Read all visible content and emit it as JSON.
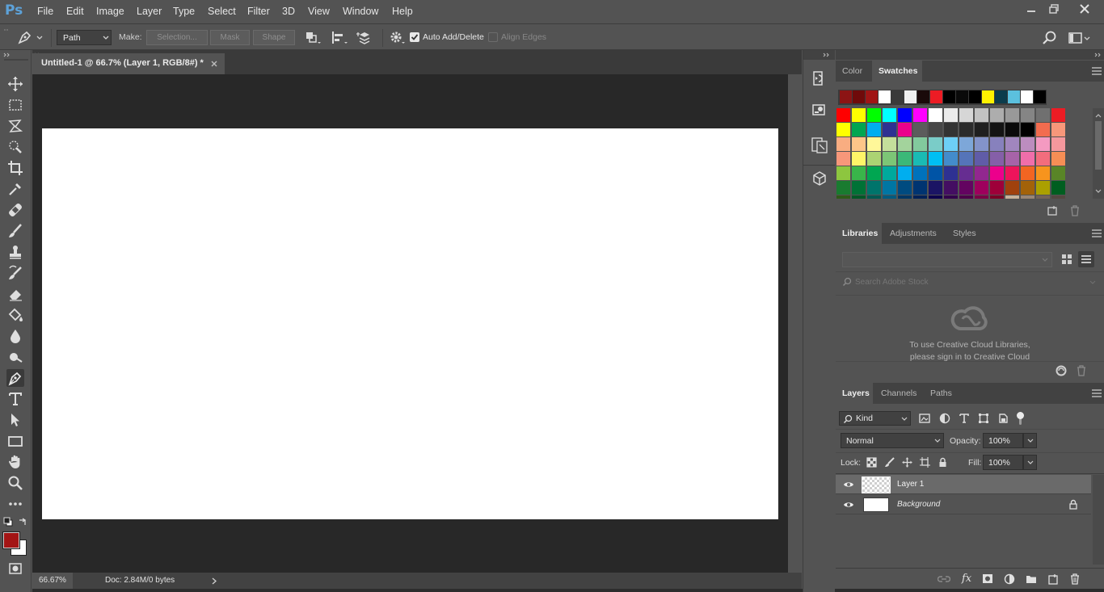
{
  "app": {
    "logo": "Ps"
  },
  "menu": [
    "File",
    "Edit",
    "Image",
    "Layer",
    "Type",
    "Select",
    "Filter",
    "3D",
    "View",
    "Window",
    "Help"
  ],
  "options": {
    "mode_value": "Path",
    "make_label": "Make:",
    "selection_btn": "Selection...",
    "mask_btn": "Mask",
    "shape_btn": "Shape",
    "auto_add_delete": "Auto Add/Delete",
    "auto_add_delete_checked": true,
    "align_edges": "Align Edges",
    "align_edges_checked": false
  },
  "document": {
    "tab_title": "Untitled-1 @ 66.7% (Layer 1, RGB/8#) *",
    "zoom": "66.67%",
    "doc_info": "Doc: 2.84M/0 bytes",
    "canvas_color": "#ffffff"
  },
  "toolbox": {
    "foreground_color": "#a31515",
    "background_color": "#ffffff",
    "active_tool": "pen-tool"
  },
  "annotation": {
    "arrow_color": "#ff0000",
    "points_to": "pen-tool"
  },
  "swatches_panel": {
    "tabs": [
      "Color",
      "Swatches"
    ],
    "active_tab": "Swatches",
    "recent": [
      "#8c1414",
      "#6f0a0a",
      "#a01515",
      "#ffffff",
      "#3a3a3a",
      "#f0f0f0",
      "#1a0a0a",
      "#ed1c24",
      "#000000",
      "#0a0a0a",
      "#000000",
      "#fff200",
      "#0b3c4c",
      "#5bc0de",
      "#ffffff",
      "#000000"
    ],
    "grid": [
      [
        "#ff0000",
        "#ffff00",
        "#00ff00",
        "#00ffff",
        "#0000ff",
        "#ff00ff",
        "#ffffff",
        "#ebebeb",
        "#d6d6d6",
        "#c2c2c2",
        "#adadad",
        "#999999",
        "#858585",
        "#707070",
        "#ed1c24"
      ],
      [
        "#ffff00",
        "#00a651",
        "#00aeef",
        "#2e3192",
        "#ec008c",
        "#5c5c5c",
        "#474747",
        "#333333",
        "#2b2b2b",
        "#1f1f1f",
        "#141414",
        "#0a0a0a",
        "#000000",
        "#f26c4f",
        "#f7977a"
      ],
      [
        "#f9ad81",
        "#fdc689",
        "#fff799",
        "#c4df9b",
        "#a3d39c",
        "#82ca9d",
        "#7accc8",
        "#6dcff6",
        "#7da7d9",
        "#8393ca",
        "#8781bd",
        "#a186be",
        "#bc8dbf",
        "#f49ac1",
        "#f5989d"
      ],
      [
        "#f7977a",
        "#fff568",
        "#acd373",
        "#7cc576",
        "#3bb878",
        "#1abbb4",
        "#00bff3",
        "#438ccb",
        "#5574b9",
        "#605ca8",
        "#855fa8",
        "#a763a8",
        "#f06eaa",
        "#f26d7d",
        "#f68e55"
      ],
      [
        "#8dc63f",
        "#39b54a",
        "#00a651",
        "#00a99d",
        "#00aeef",
        "#0072bc",
        "#0054a6",
        "#2e3192",
        "#662d91",
        "#92278f",
        "#ec008c",
        "#ed145b",
        "#f26522",
        "#f7941d",
        "#598527"
      ],
      [
        "#197b30",
        "#007236",
        "#00746b",
        "#0076a3",
        "#004b80",
        "#003471",
        "#1b1464",
        "#440e62",
        "#630460",
        "#9e005d",
        "#9e0039",
        "#a0410d",
        "#a36209",
        "#aba000",
        "#005e20"
      ],
      [
        "#2e5b18",
        "#005826",
        "#005952",
        "#005b7f",
        "#003663",
        "#002157",
        "#0d004c",
        "#32004b",
        "#4b0049",
        "#7b0046",
        "#7a0026",
        "#c7b299",
        "#998675",
        "#736357",
        "#534741"
      ]
    ]
  },
  "libraries_panel": {
    "tabs": [
      "Libraries",
      "Adjustments",
      "Styles"
    ],
    "active_tab": "Libraries",
    "search_placeholder": "Search Adobe Stock",
    "message_line1": "To use Creative Cloud Libraries,",
    "message_line2": "please sign in to Creative Cloud"
  },
  "layers_panel": {
    "tabs": [
      "Layers",
      "Channels",
      "Paths"
    ],
    "active_tab": "Layers",
    "filter_kind": "Kind",
    "blend_mode": "Normal",
    "opacity_label": "Opacity:",
    "opacity": "100%",
    "lock_label": "Lock:",
    "fill_label": "Fill:",
    "fill": "100%",
    "layers": [
      {
        "name": "Layer 1",
        "visible": true,
        "selected": true,
        "italic": false,
        "locked": false
      },
      {
        "name": "Background",
        "visible": true,
        "selected": false,
        "italic": true,
        "locked": true
      }
    ]
  }
}
